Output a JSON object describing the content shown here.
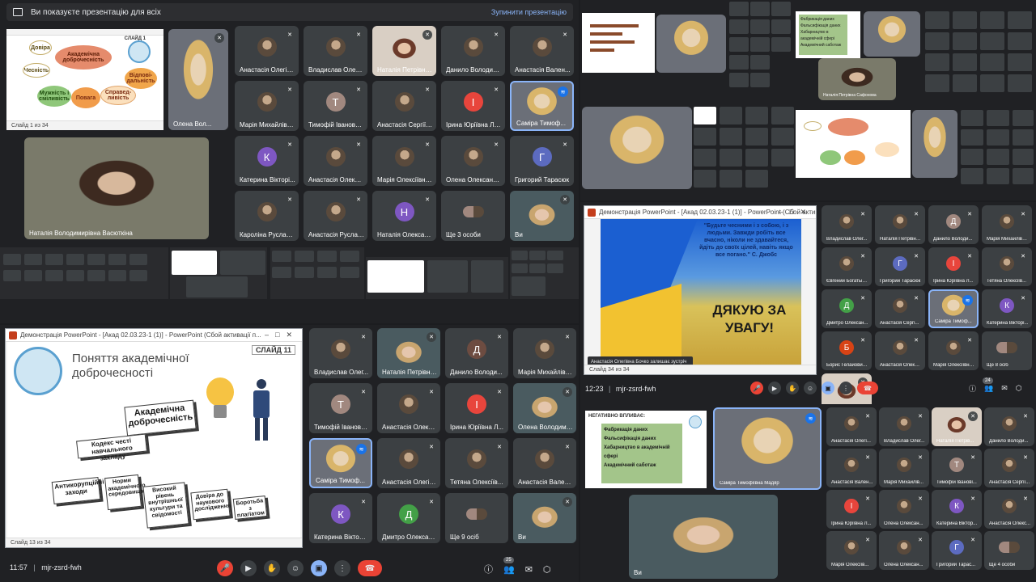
{
  "presenting_banner": {
    "text": "Ви показуєте презентацію для всіх",
    "stop": "Зупинити презентацію"
  },
  "tl": {
    "self_name": "Олена Вол...",
    "big_name": "Наталія Володимирівна Васюткіна",
    "slide_tag": "СЛАЙД 1",
    "slide_words": [
      "Довіра",
      "Чесність",
      "Академічна доброчесність",
      "Відпові-дальність",
      "Повага",
      "Справед-ливість",
      "Мужність і сміливість"
    ],
    "slide_status": "Слайд 1 из 34",
    "tiles": [
      {
        "name": "Анастасія Олегів...",
        "kind": "photo"
      },
      {
        "name": "Владислав Олего...",
        "kind": "photo"
      },
      {
        "name": "Наталія Петрівна...",
        "kind": "video"
      },
      {
        "name": "Данило Володим...",
        "kind": "photo"
      },
      {
        "name": "Анастасія Вален...",
        "kind": "photo"
      },
      {
        "name": "Марія Михайлівн...",
        "kind": "photo"
      },
      {
        "name": "Тимофій Іванович...",
        "kind": "letter",
        "letter": "Т",
        "color": "#a1887f"
      },
      {
        "name": "Анастасія Сергіїв...",
        "kind": "photo"
      },
      {
        "name": "Ірина Юріївна Лу...",
        "kind": "letter",
        "letter": "І",
        "color": "#e8453c"
      },
      {
        "name": "Саміра Тимоф...",
        "kind": "speaker"
      },
      {
        "name": "Катерина Вікторі...",
        "kind": "letter",
        "letter": "К",
        "color": "#7e57c2"
      },
      {
        "name": "Анастасія Олексі...",
        "kind": "photo"
      },
      {
        "name": "Марія Олексіївна ...",
        "kind": "photo"
      },
      {
        "name": "Олена Олександ...",
        "kind": "photo"
      },
      {
        "name": "Григорий Тарасюк",
        "kind": "letter",
        "letter": "Г",
        "color": "#5c6bc0"
      },
      {
        "name": "Кароліна Руслані...",
        "kind": "photo"
      },
      {
        "name": "Анастасія Руслан...",
        "kind": "photo"
      },
      {
        "name": "Наталія Олексан...",
        "kind": "letter",
        "letter": "Н",
        "color": "#7e57c2"
      },
      {
        "name": "Ще 3 особи",
        "kind": "group"
      },
      {
        "name": "Ви",
        "kind": "video"
      }
    ]
  },
  "tr": {
    "slide_lines": [
      "Фабрикація даних",
      "Фальсифікація даних",
      "Хабарництво в академічній сфері",
      "Академічний саботаж"
    ],
    "small_name": "Наталія Петрівна Сафонова"
  },
  "br": {
    "window_title": "Демонстрація PowerPoint - [Акад 02.03.23-1 (1)] - PowerPoint (Сбой активації п...",
    "quote": "\"Будьте чесними і з собою, і з людьми. Завжди робіть все вчасно, ніколи не здавайтеся, йдіть до своїх цілей, навіть якщо все погано.\" С. Джобс",
    "thanks": "ДЯКУЮ ЗА УВАГУ!",
    "toast": "Анастасія Олегівна Бочко залишає зустріч",
    "slide_status": "Слайд 34 из 34",
    "time": "12:23",
    "meeting_code": "mjr-zsrd-fwh",
    "people_count": "24",
    "tiles": [
      {
        "name": "Владислав Олег...",
        "kind": "photo"
      },
      {
        "name": "Наталія Петрівна...",
        "kind": "photo"
      },
      {
        "name": "Данило Володи...",
        "kind": "letter",
        "letter": "Д",
        "color": "#a1887f"
      },
      {
        "name": "Марія Михайлівн...",
        "kind": "photo"
      },
      {
        "name": "Євгений Богатыр...",
        "kind": "photo"
      },
      {
        "name": "Григорий Тарасюк",
        "kind": "letter",
        "letter": "Г",
        "color": "#5c6bc0"
      },
      {
        "name": "Ірина Юріївна Л...",
        "kind": "letter",
        "letter": "І",
        "color": "#e8453c"
      },
      {
        "name": "Тетяна Олексіїв...",
        "kind": "photo"
      },
      {
        "name": "Дмитро Олексан...",
        "kind": "letter",
        "letter": "Д",
        "color": "#43a047"
      },
      {
        "name": "Анастасія Сергі...",
        "kind": "photo"
      },
      {
        "name": "Саміра Тимоф...",
        "kind": "speaker"
      },
      {
        "name": "Катерина Вікторі...",
        "kind": "letter",
        "letter": "К",
        "color": "#7e57c2"
      },
      {
        "name": "Борис Гелайович...",
        "kind": "letter",
        "letter": "Б",
        "color": "#d84315"
      },
      {
        "name": "Анастасія Олексі...",
        "kind": "photo"
      },
      {
        "name": "Марія Олексіївна...",
        "kind": "photo"
      },
      {
        "name": "Ще 8 осіб",
        "kind": "group"
      },
      {
        "name": "Ви",
        "kind": "video"
      }
    ],
    "bottom": {
      "slide_title": "НЕГАТИВНО ВПЛИВАЄ:",
      "slide_lines": [
        "Фабрикація даних",
        "Фальсифікація даних",
        "Хабарництво в академічній сфері",
        "Академічний саботаж"
      ],
      "speaker_name": "Саміра Тимофіївна Мадяр",
      "self_name": "Ви",
      "tiles": [
        {
          "name": "Анастасія Олегі...",
          "kind": "photo"
        },
        {
          "name": "Владислав Олег...",
          "kind": "photo"
        },
        {
          "name": "Наталія Петрів...",
          "kind": "video"
        },
        {
          "name": "Данило Володи...",
          "kind": "photo"
        },
        {
          "name": "Анастасія Вален...",
          "kind": "photo"
        },
        {
          "name": "Марія Михайлів...",
          "kind": "photo"
        },
        {
          "name": "Тимофій Іванові...",
          "kind": "letter",
          "letter": "Т",
          "color": "#a1887f"
        },
        {
          "name": "Анастасія Сергії...",
          "kind": "photo"
        },
        {
          "name": "Ірина Юріївна Л...",
          "kind": "letter",
          "letter": "І",
          "color": "#e8453c"
        },
        {
          "name": "Олена Олексан...",
          "kind": "photo"
        },
        {
          "name": "Катерина Віктор...",
          "kind": "letter",
          "letter": "К",
          "color": "#7e57c2"
        },
        {
          "name": "Анастасія Олекс...",
          "kind": "photo"
        },
        {
          "name": "Марія Олексіїв...",
          "kind": "photo"
        },
        {
          "name": "Олена Олексан...",
          "kind": "photo"
        },
        {
          "name": "Григорий Тарас...",
          "kind": "letter",
          "letter": "Г",
          "color": "#5c6bc0"
        },
        {
          "name": "Ще 4 особи",
          "kind": "group"
        }
      ]
    }
  },
  "bl": {
    "window_title": "Демонстрація PowerPoint - [Акад 02.03.23-1 (1)] - PowerPoint (Сбой активації п...",
    "slide_tag": "СЛАЙД 11",
    "slide_title": "Поняття академічної доброчесності",
    "main_box": "Академічна доброчесність",
    "box2": "Кодекс честі навчального закладу",
    "boxes": [
      "Антикорупційні заходи",
      "Норми академічного середовища",
      "Високий рівень внутрішньої культури та свідомості",
      "Довіра до наукового дослідження",
      "Боротьба з плагіатом"
    ],
    "slide_status": "Слайд 13 из 34",
    "time": "11:57",
    "meeting_code": "mjr-zsrd-fwh",
    "people_count": "25",
    "tiles": [
      {
        "name": "Владислав Олег...",
        "kind": "photo"
      },
      {
        "name": "Наталія Петрівна...",
        "kind": "video"
      },
      {
        "name": "Данило Володи...",
        "kind": "letter",
        "letter": "Д",
        "color": "#6d4c41"
      },
      {
        "name": "Марія Михайлівн...",
        "kind": "photo"
      },
      {
        "name": "Тимофій Іванови...",
        "kind": "letter",
        "letter": "Т",
        "color": "#a1887f"
      },
      {
        "name": "Анастасія Олекс...",
        "kind": "photo"
      },
      {
        "name": "Ірина Юріївна Л...",
        "kind": "letter",
        "letter": "І",
        "color": "#e8453c"
      },
      {
        "name": "Олена Володими...",
        "kind": "video"
      },
      {
        "name": "Саміра Тимоф...",
        "kind": "speaker"
      },
      {
        "name": "Анастасія Олегів...",
        "kind": "photo"
      },
      {
        "name": "Тетяна Олексіїв...",
        "kind": "photo"
      },
      {
        "name": "Анастасія Вален...",
        "kind": "photo"
      },
      {
        "name": "Катерина Вікторі...",
        "kind": "letter",
        "letter": "К",
        "color": "#7e57c2"
      },
      {
        "name": "Дмитро Олексан...",
        "kind": "letter",
        "letter": "Д",
        "color": "#43a047"
      },
      {
        "name": "Ще 9 осіб",
        "kind": "group"
      },
      {
        "name": "Ви",
        "kind": "video"
      }
    ]
  }
}
